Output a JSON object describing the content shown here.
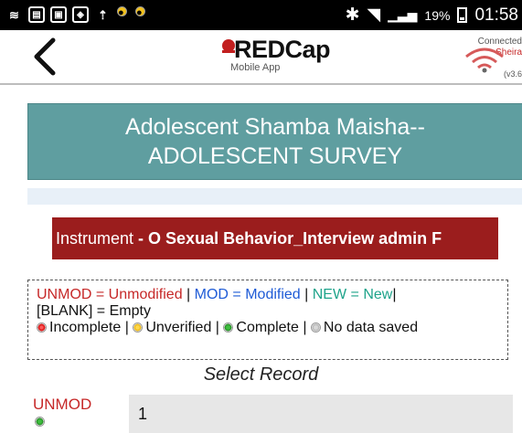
{
  "status_bar": {
    "battery": "19%",
    "time": "01:58"
  },
  "header": {
    "logo_text": "REDCap",
    "logo_sub": "Mobile App",
    "connection_label": "Connected",
    "connection_sub": "Sheira",
    "version": "(v3.6",
    "back_icon": "chevron-left-icon"
  },
  "project": {
    "title_line1": "Adolescent Shamba Maisha--",
    "title_line2": "ADOLESCENT SURVEY"
  },
  "instrument": {
    "prefix": "Instrument ",
    "name": "- O Sexual Behavior_Interview admin F"
  },
  "legend": {
    "unmod": "UNMOD = Unmodified",
    "mod": "MOD = Modified",
    "new": "NEW = New",
    "blank": "[BLANK] = Empty",
    "incomplete": "Incomplete",
    "unverified": "Unverified",
    "complete": "Complete",
    "no_data": "No data saved",
    "sep": " | "
  },
  "select_record": {
    "title": "Select Record",
    "status": "UNMOD",
    "value": "1"
  },
  "colors": {
    "project_bg": "#5f9ea0",
    "instrument_bg": "#9b1d1d",
    "unmod": "#c62828",
    "mod": "#1e5bd6",
    "new": "#1ea38a"
  }
}
